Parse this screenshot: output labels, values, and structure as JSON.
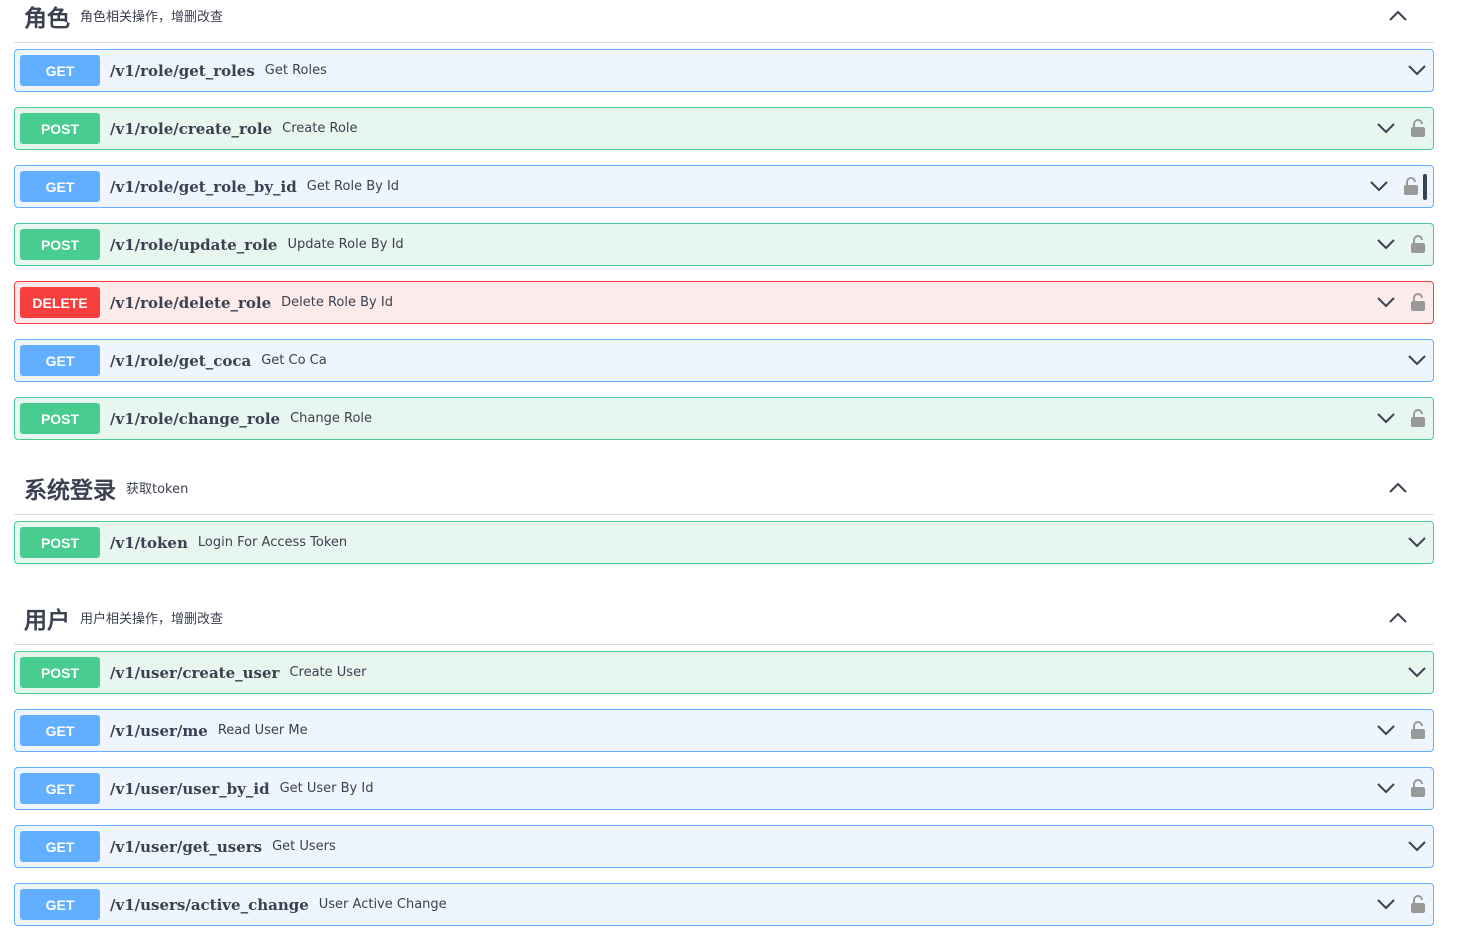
{
  "sections": {
    "role": {
      "title": "角色",
      "desc": "角色相关操作，增删改查",
      "ops": [
        {
          "method": "GET",
          "path": "/v1/role/get_roles",
          "summary": "Get Roles"
        },
        {
          "method": "POST",
          "path": "/v1/role/create_role",
          "summary": "Create Role"
        },
        {
          "method": "GET",
          "path": "/v1/role/get_role_by_id",
          "summary": "Get Role By Id"
        },
        {
          "method": "POST",
          "path": "/v1/role/update_role",
          "summary": "Update Role By Id"
        },
        {
          "method": "DELETE",
          "path": "/v1/role/delete_role",
          "summary": "Delete Role By Id"
        },
        {
          "method": "GET",
          "path": "/v1/role/get_coca",
          "summary": "Get Co Ca"
        },
        {
          "method": "POST",
          "path": "/v1/role/change_role",
          "summary": "Change Role"
        }
      ]
    },
    "login": {
      "title": "系统登录",
      "desc": "获取token",
      "ops": [
        {
          "method": "POST",
          "path": "/v1/token",
          "summary": "Login For Access Token"
        }
      ]
    },
    "user": {
      "title": "用户",
      "desc": "用户相关操作，增删改查",
      "ops": [
        {
          "method": "POST",
          "path": "/v1/user/create_user",
          "summary": "Create User"
        },
        {
          "method": "GET",
          "path": "/v1/user/me",
          "summary": "Read User Me"
        },
        {
          "method": "GET",
          "path": "/v1/user/user_by_id",
          "summary": "Get User By Id"
        },
        {
          "method": "GET",
          "path": "/v1/user/get_users",
          "summary": "Get Users"
        },
        {
          "method": "GET",
          "path": "/v1/users/active_change",
          "summary": "User Active Change"
        }
      ]
    }
  },
  "colors": {
    "get": "#61affe",
    "post": "#49cc90",
    "delete": "#f93e3e",
    "text": "#3b4151"
  },
  "icons": {
    "expand": "chevron-down-icon",
    "collapse": "chevron-up-icon",
    "auth": "lock-icon"
  }
}
